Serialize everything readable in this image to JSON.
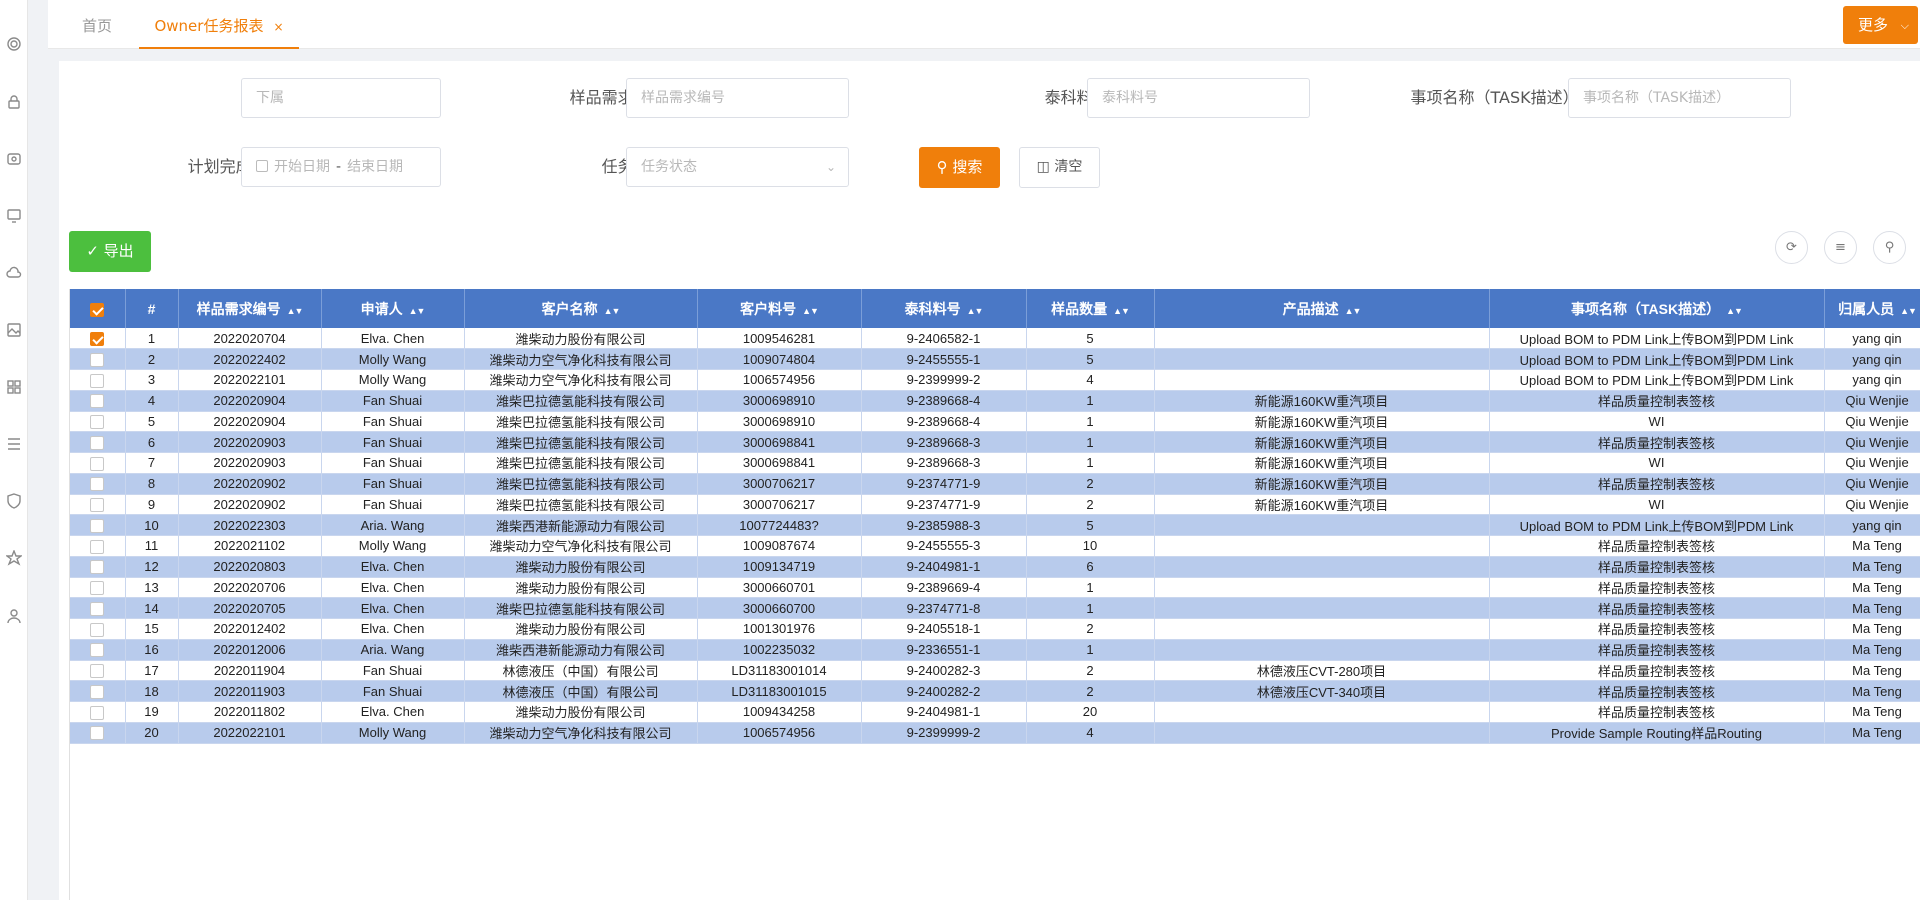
{
  "tabs": {
    "home": "首页",
    "active": "Owner任务报表",
    "close": "×",
    "more": "更多"
  },
  "sidebar_icons": [
    "gear-icon",
    "lock-icon",
    "badge-icon",
    "monitor-icon",
    "cloud-icon",
    "image-icon",
    "grid-icon",
    "list-icon",
    "shield-icon",
    "star-icon",
    "user-icon"
  ],
  "filters": {
    "subordinate": {
      "label": "下属:",
      "placeholder": "下属"
    },
    "sample_req_no": {
      "label": "样品需求编号:",
      "placeholder": "样品需求编号"
    },
    "taike_part_no": {
      "label": "泰科料号:",
      "placeholder": "泰科料号"
    },
    "task_name": {
      "label": "事项名称（TASK描述）:",
      "placeholder": "事项名称（TASK描述）"
    },
    "plan_date": {
      "label": "计划完成日期:",
      "start": "开始日期",
      "sep": "-",
      "end": "结束日期"
    },
    "task_status": {
      "label": "任务状态:",
      "placeholder": "任务状态"
    }
  },
  "buttons": {
    "search": "搜索",
    "clear": "清空",
    "export": "导出"
  },
  "table": {
    "columns": [
      "#",
      "样品需求编号",
      "申请人",
      "客户名称",
      "客户料号",
      "泰科料号",
      "样品数量",
      "产品描述",
      "事项名称（TASK描述）",
      "归属人员"
    ],
    "rows": [
      [
        "1",
        "2022020704",
        "Elva. Chen",
        "潍柴动力股份有限公司",
        "1009546281",
        "9-2406582-1",
        "5",
        "",
        "Upload BOM to PDM Link上传BOM到PDM Link",
        "yang qin"
      ],
      [
        "2",
        "2022022402",
        "Molly Wang",
        "潍柴动力空气净化科技有限公司",
        "1009074804",
        "9-2455555-1",
        "5",
        "",
        "Upload BOM to PDM Link上传BOM到PDM Link",
        "yang qin"
      ],
      [
        "3",
        "2022022101",
        "Molly Wang",
        "潍柴动力空气净化科技有限公司",
        "1006574956",
        "9-2399999-2",
        "4",
        "",
        "Upload BOM to PDM Link上传BOM到PDM Link",
        "yang qin"
      ],
      [
        "4",
        "2022020904",
        "Fan Shuai",
        "潍柴巴拉德氢能科技有限公司",
        "3000698910",
        "9-2389668-4",
        "1",
        "新能源160KW重汽项目",
        "样品质量控制表签核",
        "Qiu Wenjie"
      ],
      [
        "5",
        "2022020904",
        "Fan Shuai",
        "潍柴巴拉德氢能科技有限公司",
        "3000698910",
        "9-2389668-4",
        "1",
        "新能源160KW重汽项目",
        "WI",
        "Qiu Wenjie"
      ],
      [
        "6",
        "2022020903",
        "Fan Shuai",
        "潍柴巴拉德氢能科技有限公司",
        "3000698841",
        "9-2389668-3",
        "1",
        "新能源160KW重汽项目",
        "样品质量控制表签核",
        "Qiu Wenjie"
      ],
      [
        "7",
        "2022020903",
        "Fan Shuai",
        "潍柴巴拉德氢能科技有限公司",
        "3000698841",
        "9-2389668-3",
        "1",
        "新能源160KW重汽项目",
        "WI",
        "Qiu Wenjie"
      ],
      [
        "8",
        "2022020902",
        "Fan Shuai",
        "潍柴巴拉德氢能科技有限公司",
        "3000706217",
        "9-2374771-9",
        "2",
        "新能源160KW重汽项目",
        "样品质量控制表签核",
        "Qiu Wenjie"
      ],
      [
        "9",
        "2022020902",
        "Fan Shuai",
        "潍柴巴拉德氢能科技有限公司",
        "3000706217",
        "9-2374771-9",
        "2",
        "新能源160KW重汽项目",
        "WI",
        "Qiu Wenjie"
      ],
      [
        "10",
        "2022022303",
        "Aria. Wang",
        "潍柴西港新能源动力有限公司",
        "1007724483?",
        "9-2385988-3",
        "5",
        "",
        "Upload BOM to PDM Link上传BOM到PDM Link",
        "yang qin"
      ],
      [
        "11",
        "2022021102",
        "Molly Wang",
        "潍柴动力空气净化科技有限公司",
        "1009087674",
        "9-2455555-3",
        "10",
        "",
        "样品质量控制表签核",
        "Ma Teng"
      ],
      [
        "12",
        "2022020803",
        "Elva. Chen",
        "潍柴动力股份有限公司",
        "1009134719",
        "9-2404981-1",
        "6",
        "",
        "样品质量控制表签核",
        "Ma Teng"
      ],
      [
        "13",
        "2022020706",
        "Elva. Chen",
        "潍柴动力股份有限公司",
        "3000660701",
        "9-2389669-4",
        "1",
        "",
        "样品质量控制表签核",
        "Ma Teng"
      ],
      [
        "14",
        "2022020705",
        "Elva. Chen",
        "潍柴巴拉德氢能科技有限公司",
        "3000660700",
        "9-2374771-8",
        "1",
        "",
        "样品质量控制表签核",
        "Ma Teng"
      ],
      [
        "15",
        "2022012402",
        "Elva. Chen",
        "潍柴动力股份有限公司",
        "1001301976",
        "9-2405518-1",
        "2",
        "",
        "样品质量控制表签核",
        "Ma Teng"
      ],
      [
        "16",
        "2022012006",
        "Aria. Wang",
        "潍柴西港新能源动力有限公司",
        "1002235032",
        "9-2336551-1",
        "1",
        "",
        "样品质量控制表签核",
        "Ma Teng"
      ],
      [
        "17",
        "2022011904",
        "Fan Shuai",
        "林德液压（中国）有限公司",
        "LD31183001014",
        "9-2400282-3",
        "2",
        "林德液压CVT-280项目",
        "样品质量控制表签核",
        "Ma Teng"
      ],
      [
        "18",
        "2022011903",
        "Fan Shuai",
        "林德液压（中国）有限公司",
        "LD31183001015",
        "9-2400282-2",
        "2",
        "林德液压CVT-340项目",
        "样品质量控制表签核",
        "Ma Teng"
      ],
      [
        "19",
        "2022011802",
        "Elva. Chen",
        "潍柴动力股份有限公司",
        "1009434258",
        "9-2404981-1",
        "20",
        "",
        "样品质量控制表签核",
        "Ma Teng"
      ],
      [
        "20",
        "2022022101",
        "Molly Wang",
        "潍柴动力空气净化科技有限公司",
        "1006574956",
        "9-2399999-2",
        "4",
        "",
        "Provide Sample Routing样品Routing",
        "Ma Teng"
      ]
    ],
    "selected_rows": [
      1
    ]
  },
  "colors": {
    "accent": "#f07f0b",
    "header": "#4a78c6",
    "stripe": "#b8cbec",
    "export": "#4cbf3e"
  }
}
